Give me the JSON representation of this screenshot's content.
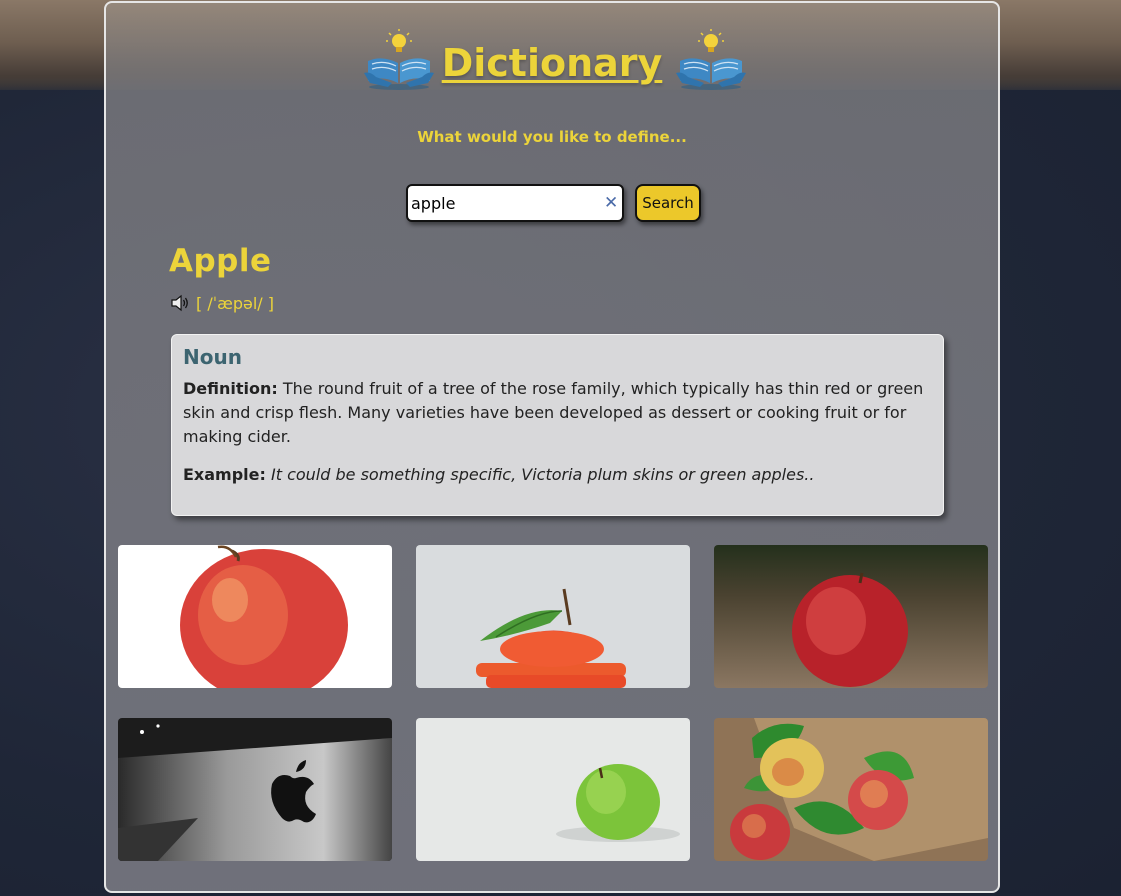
{
  "app": {
    "title": "Dictionary",
    "subtitle": "What would you like to define..."
  },
  "search": {
    "value": "apple",
    "button_label": "Search",
    "clear_icon": "close-icon"
  },
  "result": {
    "word": "Apple",
    "phonetic": "[ /ˈæpəl/ ]",
    "meanings": [
      {
        "part_of_speech": "Noun",
        "definition_label": "Definition:",
        "definition": "The round fruit of a tree of the rose family, which typically has thin red or green skin and crisp flesh. Many varieties have been developed as dessert or cooking fruit or for making cider.",
        "example_label": "Example:",
        "example": "It could be something specific, Victoria plum skins or green apples.."
      }
    ]
  },
  "photos": [
    {
      "subject": "red apple on white background"
    },
    {
      "subject": "sliced red apple with leaf"
    },
    {
      "subject": "red apple on wooden table"
    },
    {
      "subject": "apple logo on computer"
    },
    {
      "subject": "green apple on white surface"
    },
    {
      "subject": "apples with leaves on burlap"
    }
  ],
  "colors": {
    "accent": "#ecd43a",
    "button": "#ecc82a",
    "card_bg": "#d8d8da",
    "pos_heading": "#3c6470"
  }
}
